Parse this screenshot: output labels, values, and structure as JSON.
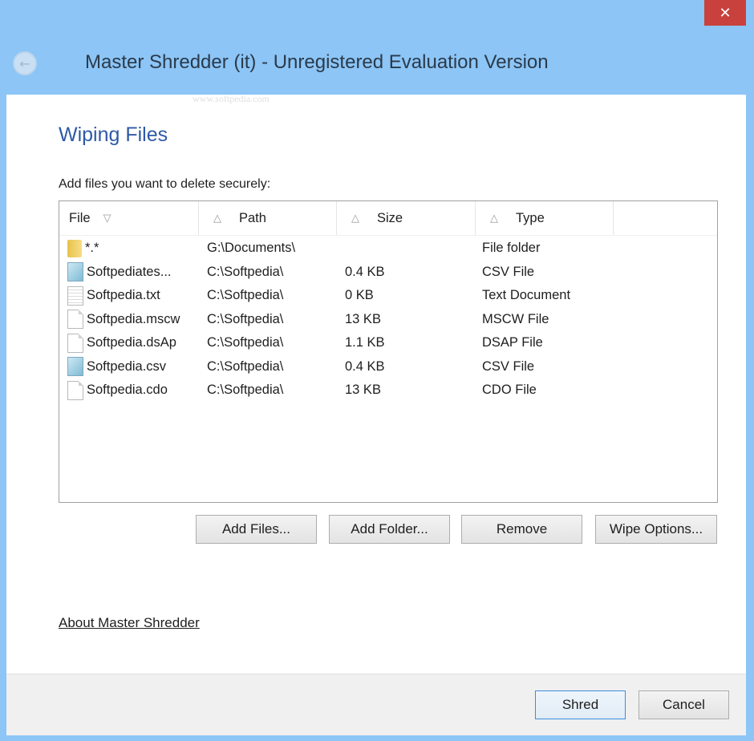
{
  "window": {
    "title": "Master Shredder (it) - Unregistered Evaluation Version",
    "close_label": "✕",
    "back_icon": "←",
    "watermark": "www.softpedia.com"
  },
  "page": {
    "heading": "Wiping Files",
    "instruction": "Add files you want to delete securely:"
  },
  "list": {
    "columns": [
      {
        "label": "File",
        "sort": "▽"
      },
      {
        "label": "Path",
        "sort": "△"
      },
      {
        "label": "Size",
        "sort": "△"
      },
      {
        "label": "Type",
        "sort": "△"
      }
    ],
    "rows": [
      {
        "icon": "folder-icon",
        "file": "*.*",
        "path": "G:\\Documents\\",
        "size": "",
        "type": "File folder"
      },
      {
        "icon": "csv-file-icon",
        "file": "Softpediates...",
        "path": "C:\\Softpedia\\",
        "size": "0.4 KB",
        "type": "CSV File"
      },
      {
        "icon": "text-file-icon",
        "file": "Softpedia.txt",
        "path": "C:\\Softpedia\\",
        "size": "0 KB",
        "type": "Text Document"
      },
      {
        "icon": "generic-file-icon",
        "file": "Softpedia.mscw",
        "path": "C:\\Softpedia\\",
        "size": "13 KB",
        "type": "MSCW File"
      },
      {
        "icon": "generic-file-icon",
        "file": "Softpedia.dsAp",
        "path": "C:\\Softpedia\\",
        "size": "1.1 KB",
        "type": "DSAP File"
      },
      {
        "icon": "csv-file-icon",
        "file": "Softpedia.csv",
        "path": "C:\\Softpedia\\",
        "size": "0.4 KB",
        "type": "CSV File"
      },
      {
        "icon": "generic-file-icon",
        "file": "Softpedia.cdo",
        "path": "C:\\Softpedia\\",
        "size": "13 KB",
        "type": "CDO File"
      }
    ]
  },
  "buttons": {
    "add_files": "Add Files...",
    "add_folder": "Add Folder...",
    "remove": "Remove",
    "wipe_options": "Wipe Options...",
    "shred": "Shred",
    "cancel": "Cancel"
  },
  "links": {
    "about": "About Master Shredder"
  }
}
